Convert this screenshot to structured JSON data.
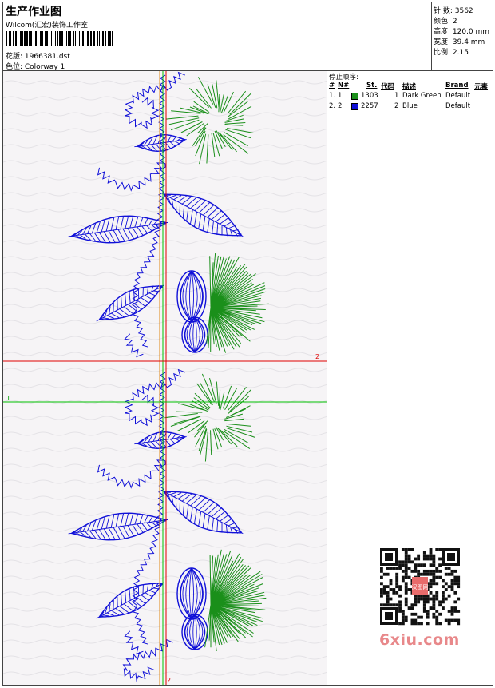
{
  "header": {
    "title": "生产作业图",
    "company": "Wilcom(汇宏)装饰工作室",
    "design_file": "花版: 1966381.dst",
    "colorway": "色位: Colorway 1"
  },
  "stats": {
    "stitches": "针 数: 3562",
    "colors": "颜色: 2",
    "height": "高度: 120.0 mm",
    "width": "宽度: 39.4 mm",
    "scale": "比例: 2.15"
  },
  "stop_sequence": {
    "title": "停止顺序:",
    "columns": [
      "#",
      "N#",
      "St.",
      "代码",
      "描述",
      "Brand",
      "元素"
    ],
    "rows": [
      {
        "num": "1.",
        "needle": "1",
        "color": "#1a8f1a",
        "stitches": "1303",
        "code": "1",
        "desc": "Dark Green",
        "brand": "Default"
      },
      {
        "num": "2.",
        "needle": "2",
        "color": "#1010d8",
        "stitches": "2257",
        "code": "2",
        "desc": "Blue",
        "brand": "Default"
      }
    ]
  },
  "crosshair": {
    "h_red_label": "2",
    "h_green_label": "1",
    "v_red_label": "2"
  },
  "watermark": {
    "site": "6xiu.com",
    "qr_badge": "汉图网"
  },
  "colors": {
    "green_thread": "#1a8f1a",
    "blue_thread": "#1010d8",
    "guide_red": "#e00000",
    "guide_green": "#00c000",
    "guide_orange": "#e08a1a"
  }
}
